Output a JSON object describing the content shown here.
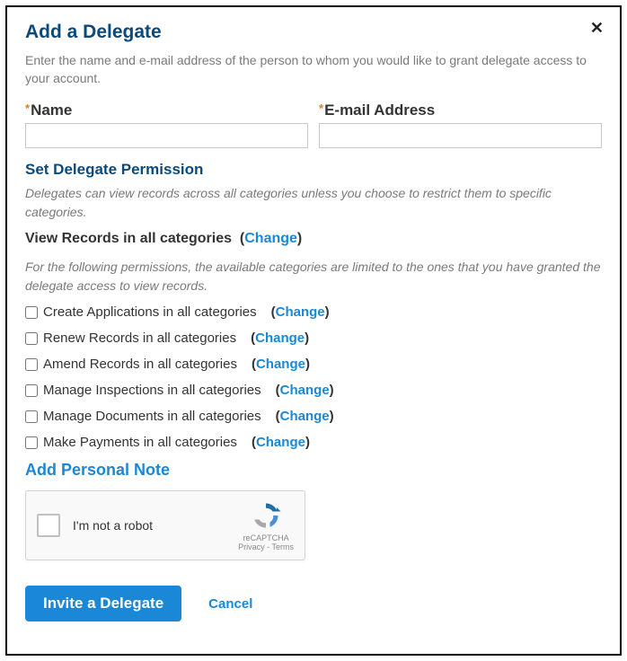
{
  "modal": {
    "title": "Add a Delegate",
    "close_symbol": "✕",
    "intro": "Enter the name and e-mail address of the person to whom you would like to grant delegate access to your account."
  },
  "form": {
    "name_label": "Name",
    "name_value": "",
    "email_label": "E-mail Address",
    "email_value": ""
  },
  "permissions": {
    "heading": "Set Delegate Permission",
    "help1": "Delegates can view records across all categories unless you choose to restrict them to specific categories.",
    "view_label": "View Records in all categories",
    "change_label": "Change",
    "help2": "For the following permissions, the available categories are limited to the ones that you have granted the delegate access to view records.",
    "items": [
      {
        "label": "Create Applications in all categories"
      },
      {
        "label": "Renew Records in all categories"
      },
      {
        "label": "Amend Records in all categories"
      },
      {
        "label": "Manage Inspections in all categories"
      },
      {
        "label": "Manage Documents in all categories"
      },
      {
        "label": "Make Payments in all categories"
      }
    ]
  },
  "note": {
    "add_label": "Add Personal Note"
  },
  "recaptcha": {
    "label": "I'm not a robot",
    "brand": "reCAPTCHA",
    "legal": "Privacy - Terms"
  },
  "actions": {
    "invite_label": "Invite a Delegate",
    "cancel_label": "Cancel"
  }
}
